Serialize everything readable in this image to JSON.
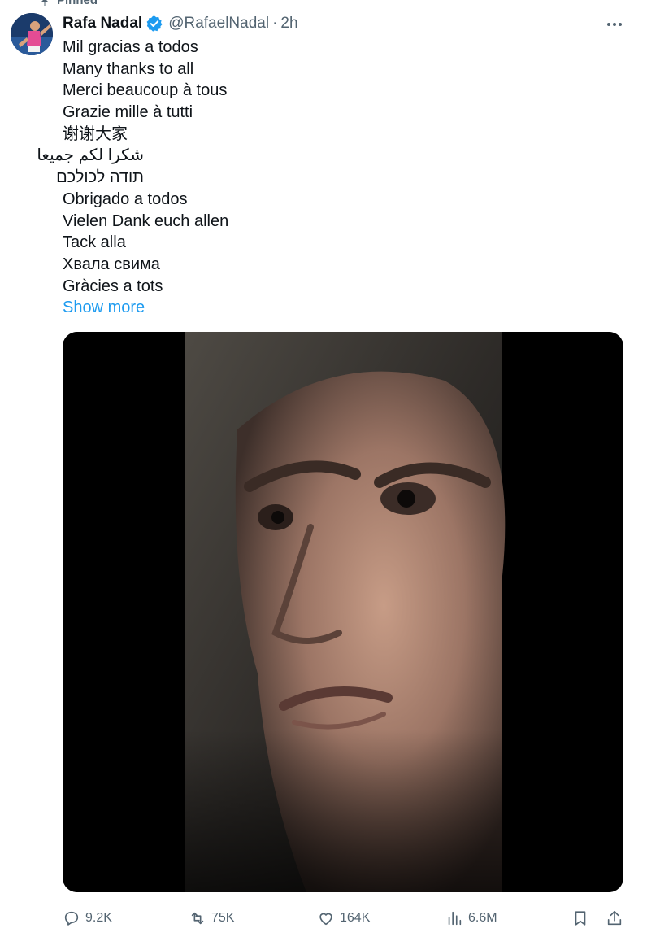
{
  "tweet": {
    "pinned_label": "Pinned",
    "author": {
      "name": "Rafa Nadal",
      "handle": "@RafaelNadal",
      "verified": true
    },
    "separator": "·",
    "time": "2h",
    "lines": [
      "Mil gracias a todos",
      "Many thanks to all",
      "Merci beaucoup à tous",
      "Grazie mille à tutti",
      "谢谢大家",
      "شكرا لكم جميعا",
      "תודה לכולכם",
      "Obrigado a todos",
      "Vielen Dank euch allen",
      "Tack alla",
      "Хвала свима",
      "Gràcies a tots"
    ],
    "show_more": "Show more",
    "stats": {
      "replies": "9.2K",
      "reposts": "75K",
      "likes": "164K",
      "views": "6.6M"
    }
  },
  "colors": {
    "accent": "#1d9bf0",
    "secondary_text": "#536471",
    "primary_text": "#0f1419"
  },
  "icons": [
    "pin-icon",
    "verified-badge-icon",
    "more-icon",
    "reply-icon",
    "repost-icon",
    "like-icon",
    "views-icon",
    "bookmark-icon",
    "share-icon"
  ]
}
